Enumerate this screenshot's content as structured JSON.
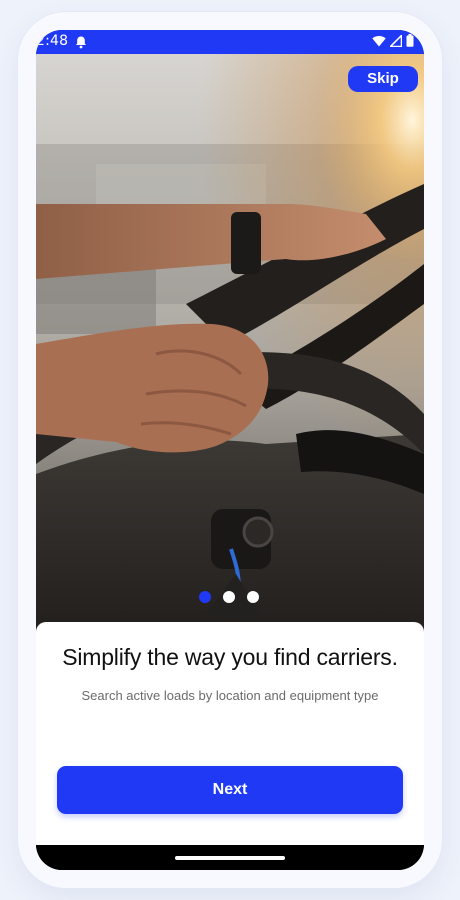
{
  "status_bar": {
    "time": "2:48",
    "icons": [
      "bell-icon",
      "wifi-icon",
      "signal-icon",
      "battery-icon"
    ]
  },
  "onboarding": {
    "skip_label": "Skip",
    "headline": "Simplify the way you find carriers.",
    "subtext": "Search active loads by location and equipment type",
    "next_label": "Next",
    "page_indicator": {
      "current": 1,
      "total": 3
    }
  },
  "colors": {
    "accent": "#1F39F5",
    "dot_inactive": "#FFFFFF",
    "text_primary": "#111111",
    "text_secondary": "#6B6B6B"
  }
}
